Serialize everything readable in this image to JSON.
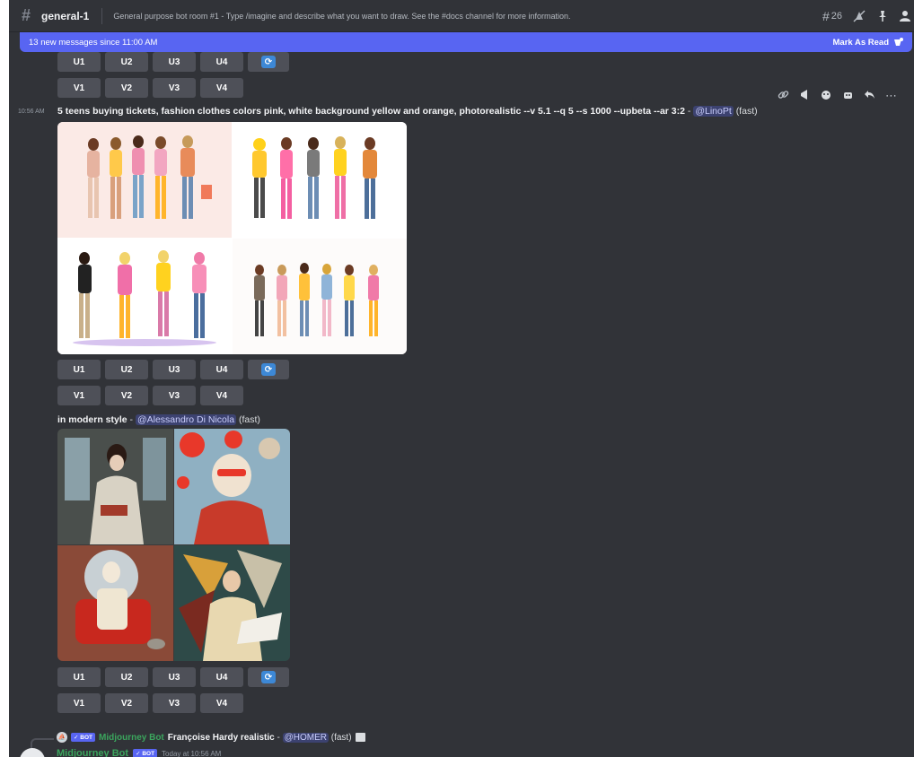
{
  "header": {
    "channel": "general-1",
    "topic": "General purpose bot room #1 - Type /imagine and describe what you want to draw. See the #docs channel for more information.",
    "threads_count": "26"
  },
  "banner": {
    "text": "13 new messages since 11:00 AM",
    "action": "Mark As Read"
  },
  "buttons": {
    "upscale": [
      "U1",
      "U2",
      "U3",
      "U4"
    ],
    "variation": [
      "V1",
      "V2",
      "V3",
      "V4"
    ]
  },
  "message1": {
    "timestamp": "10:56 AM",
    "prompt": "5 teens buying tickets, fashion clothes colors pink, white background yellow and orange, photorealistic --v 5.1 --q 5 --s 1000 --upbeta --ar 3:2",
    "separator": " - ",
    "mention": "@LinoPt",
    "mode": "(fast)"
  },
  "message2": {
    "prompt": "in modern style",
    "separator": " - ",
    "mention": "@Alessandro Di Nicola",
    "mode": "(fast)"
  },
  "reply": {
    "bot_tag": "✓ BOT",
    "bot_name": "Midjourney Bot",
    "prompt": "Françoise Hardy realistic",
    "separator": " - ",
    "mention": "@HOMER",
    "mode": "(fast)"
  },
  "next_message": {
    "author": "Midjourney Bot",
    "bot_tag": "✓ BOT",
    "time": "Today at 10:56 AM"
  },
  "colors": {
    "background": "#313338",
    "blurple": "#5865f2",
    "button": "#4e5058",
    "reroll": "#3d88d6",
    "bot_green": "#3ba55d"
  }
}
